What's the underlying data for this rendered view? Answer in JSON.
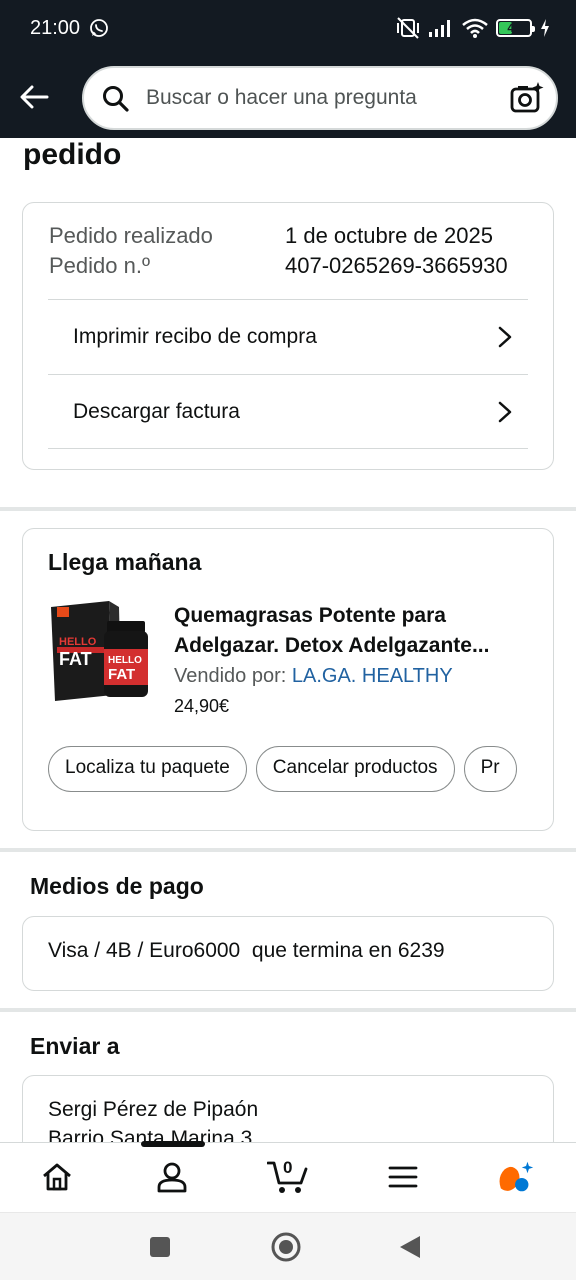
{
  "status_bar": {
    "time": "21:00",
    "battery": "43",
    "battery_level": 0.43
  },
  "search": {
    "placeholder": "Buscar o hacer una pregunta"
  },
  "page": {
    "title": "pedido"
  },
  "order": {
    "placed_label": "Pedido realizado",
    "placed_value": "1 de octubre de 2025",
    "number_label": "Pedido n.º",
    "number_value": "407-0265269-3665930",
    "links": [
      "Imprimir recibo de compra",
      "Descargar factura"
    ]
  },
  "delivery": {
    "heading": "Llega mañana",
    "product_title_line1": "Quemagrasas Potente para",
    "product_title_line2": "Adelgazar. Detox Adelgazante...",
    "sold_by_label": "Vendido por:",
    "seller": "LA.GA. HEALTHY",
    "price": "24,90€",
    "image_brand": "HELLO",
    "image_brand2": "FAT",
    "actions": [
      "Localiza tu paquete",
      "Cancelar productos",
      "Pr"
    ]
  },
  "payment": {
    "heading": "Medios de pago",
    "method": "Visa / 4B / Euro6000  que termina en 6239"
  },
  "shipping": {
    "heading": "Enviar a",
    "name": "Sergi Pérez de Pipaón",
    "address_line": "Barrio Santa Marina 3"
  },
  "bottom_nav": {
    "cart_count": "0"
  },
  "colors": {
    "header_bg": "#131a22",
    "link": "#2162a1",
    "alexa_orange": "#ff6a00",
    "alexa_blue": "#0078d4"
  }
}
